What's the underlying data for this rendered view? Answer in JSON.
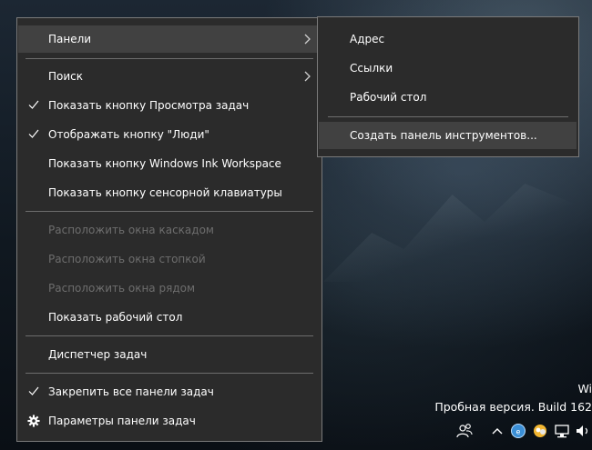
{
  "main_menu": {
    "items": [
      {
        "label": "Панели",
        "submenu": true,
        "highlighted": true
      },
      {
        "label": "Поиск",
        "submenu": true
      },
      {
        "label": "Показать кнопку Просмотра задач",
        "checked": true
      },
      {
        "label": "Отображать кнопку \"Люди\"",
        "checked": true
      },
      {
        "label": "Показать кнопку Windows Ink Workspace"
      },
      {
        "label": "Показать кнопку сенсорной клавиатуры"
      },
      {
        "label": "Расположить окна каскадом",
        "disabled": true
      },
      {
        "label": "Расположить окна стопкой",
        "disabled": true
      },
      {
        "label": "Расположить окна рядом",
        "disabled": true
      },
      {
        "label": "Показать рабочий стол"
      },
      {
        "label": "Диспетчер задач"
      },
      {
        "label": "Закрепить все панели задач",
        "checked": true
      },
      {
        "label": "Параметры панели задач",
        "icon": "gear-icon"
      }
    ]
  },
  "sub_menu": {
    "items": [
      {
        "label": "Адрес"
      },
      {
        "label": "Ссылки"
      },
      {
        "label": "Рабочий стол"
      },
      {
        "label": "Создать панель инструментов...",
        "highlighted": true
      }
    ]
  },
  "watermark": {
    "line1": "Wi",
    "line2": "Пробная версия. Build 162"
  },
  "tray": {
    "icons": [
      "people-icon",
      "chevron-up-icon",
      "network-globe-icon",
      "weather-icon",
      "display-network-icon",
      "volume-icon"
    ]
  }
}
